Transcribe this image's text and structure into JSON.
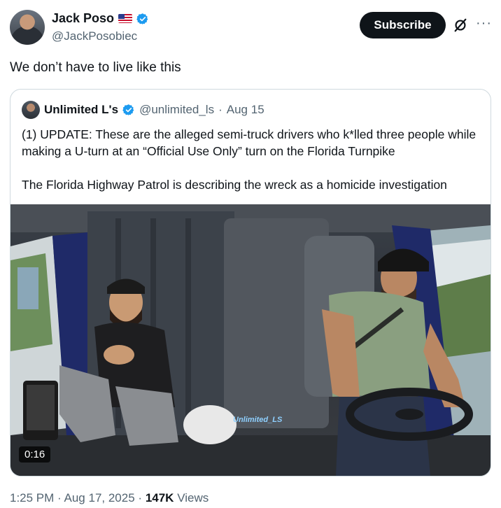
{
  "header": {
    "author_name": "Jack Poso",
    "author_handle": "@JackPosobiec",
    "subscribe_label": "Subscribe",
    "more_label": "···"
  },
  "tweet": {
    "text": "We don’t have to live like this"
  },
  "quote": {
    "name": "Unlimited L's",
    "handle": "@unlimited_ls",
    "sep": "·",
    "date": "Aug 15",
    "paragraph_1": "(1) UPDATE: These are the alleged semi-truck drivers who k*lled three people while making a U-turn at an “Official Use Only” turn on the Florida Turnpike",
    "paragraph_2": "The Florida Highway Patrol is describing the wreck as a homicide investigation",
    "video": {
      "duration": "0:16",
      "watermark": "Unlimited_LS"
    }
  },
  "footer": {
    "time": "1:25 PM",
    "sep1": "·",
    "date": "Aug 17, 2025",
    "sep2": "·",
    "views_count": "147K",
    "views_label": "Views"
  },
  "colors": {
    "text_primary": "#0f1419",
    "text_secondary": "#536471",
    "verified_blue": "#1d9bf0",
    "border": "#cfd9de",
    "button_dark": "#0f1419"
  }
}
